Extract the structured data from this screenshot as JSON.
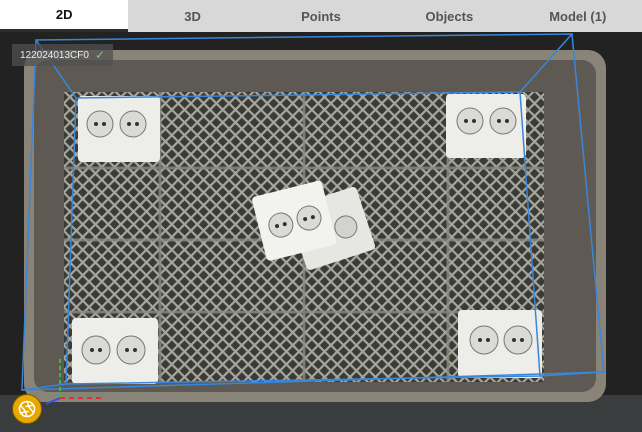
{
  "tabs": [
    {
      "label": "2D",
      "active": true
    },
    {
      "label": "3D",
      "active": false
    },
    {
      "label": "Points",
      "active": false
    },
    {
      "label": "Objects",
      "active": false
    },
    {
      "label": "Model (1)",
      "active": false
    }
  ],
  "viewer": {
    "camera_id": "122024013CF0",
    "camera_status_icon": "check-icon",
    "snapshot_icon": "aperture-icon",
    "bbox_color": "#3a86d8"
  }
}
